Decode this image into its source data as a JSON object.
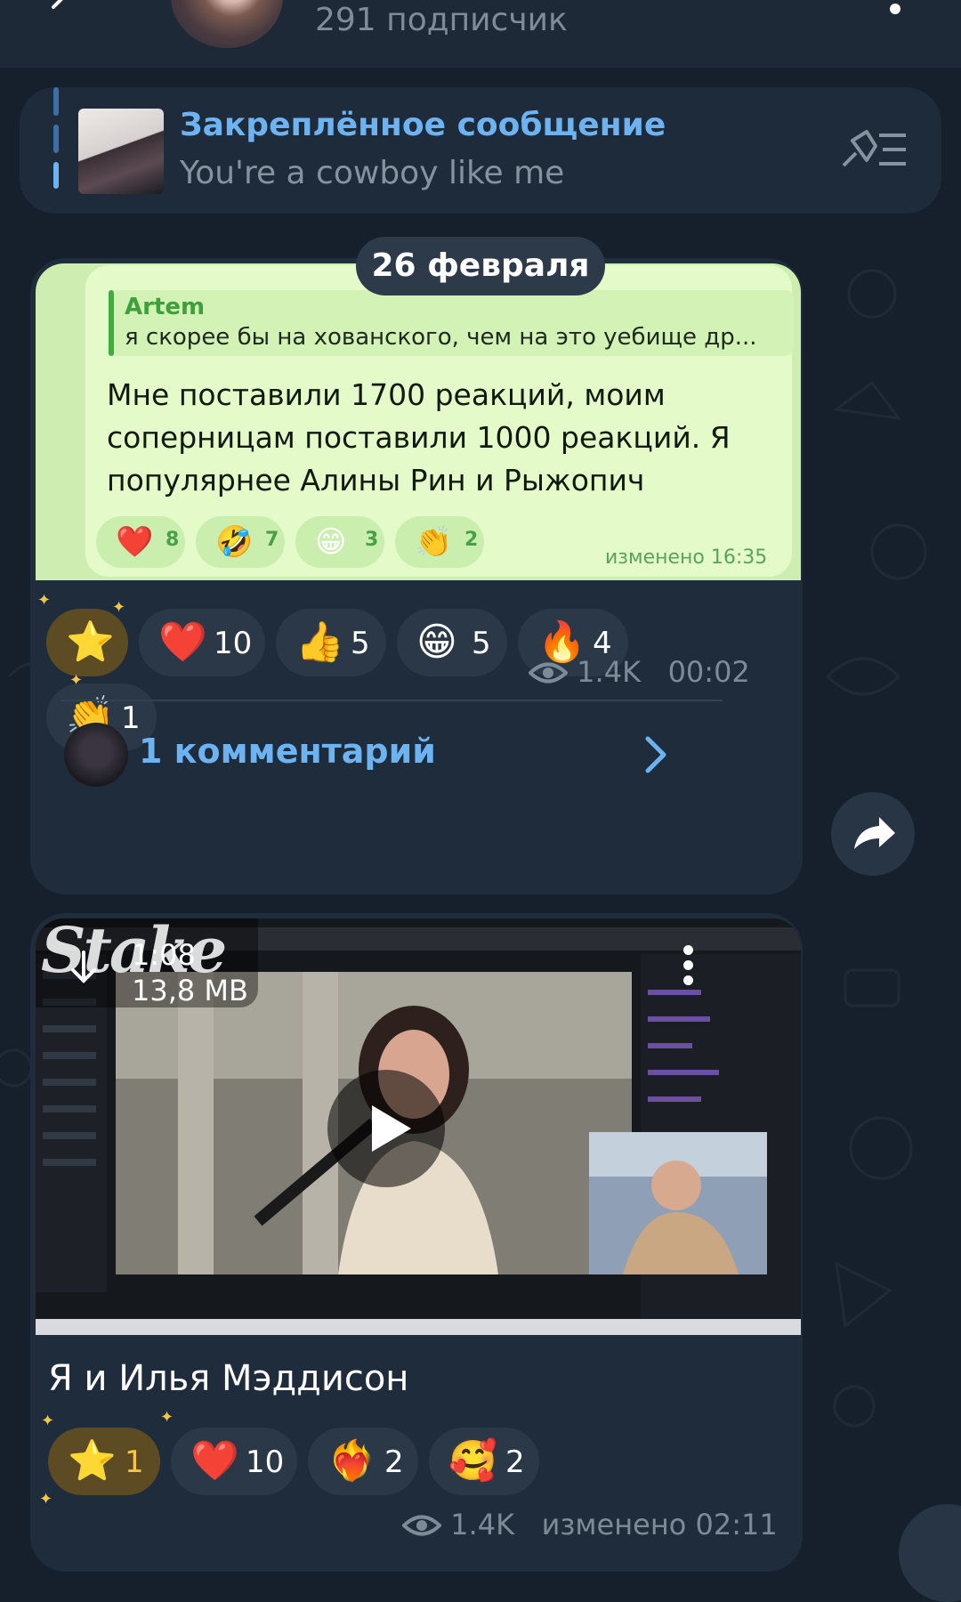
{
  "header": {
    "subscribers": "291 подписчик",
    "back_icon": "back-arrow-icon",
    "menu_icon": "more-vertical-icon"
  },
  "pinned": {
    "title": "Закреплённое сообщение",
    "text": "You're a cowboy like me",
    "icon": "pin-list-icon"
  },
  "date_chip": "26 февраля",
  "post1": {
    "reply": {
      "name": "Artem",
      "text": "я скорее бы на хованского, чем на это уебище др..."
    },
    "message": "Мне поставили 1700 реакций, моим соперницам поставили 1000 реакций. Я популярнее Алины Рин и Рыжопич",
    "sticker_reactions": [
      {
        "emoji": "❤️",
        "count": "8"
      },
      {
        "emoji": "🤣",
        "count": "7"
      },
      {
        "emoji": "😁",
        "count": "3"
      },
      {
        "emoji": "👏",
        "count": "2"
      }
    ],
    "sticker_edited": "изменено 16:35",
    "reactions": [
      {
        "emoji": "⭐",
        "count": ""
      },
      {
        "emoji": "❤️",
        "count": "10"
      },
      {
        "emoji": "👍",
        "count": "5"
      },
      {
        "emoji": "😁",
        "count": "5"
      },
      {
        "emoji": "🔥",
        "count": "4"
      },
      {
        "emoji": "👏",
        "count": "1"
      }
    ],
    "views": "1.4K",
    "time": "00:02",
    "comments": "1 комментарий"
  },
  "post2": {
    "video_duration": "1:08",
    "video_size": "13,8 MB",
    "video_watermark": "Stake",
    "caption": "Я и Илья Мэддисон",
    "reactions": [
      {
        "emoji": "⭐",
        "count": "1"
      },
      {
        "emoji": "❤️",
        "count": "10"
      },
      {
        "emoji": "❤️‍🔥",
        "count": "2"
      },
      {
        "emoji": "🥰",
        "count": "2"
      }
    ],
    "views": "1.4K",
    "edited": "изменено 02:11"
  },
  "colors": {
    "accent": "#6db3f2",
    "background": "#15202c",
    "bubble": "#1f2c3b",
    "sticker_bubble": "#e4fbc9"
  }
}
